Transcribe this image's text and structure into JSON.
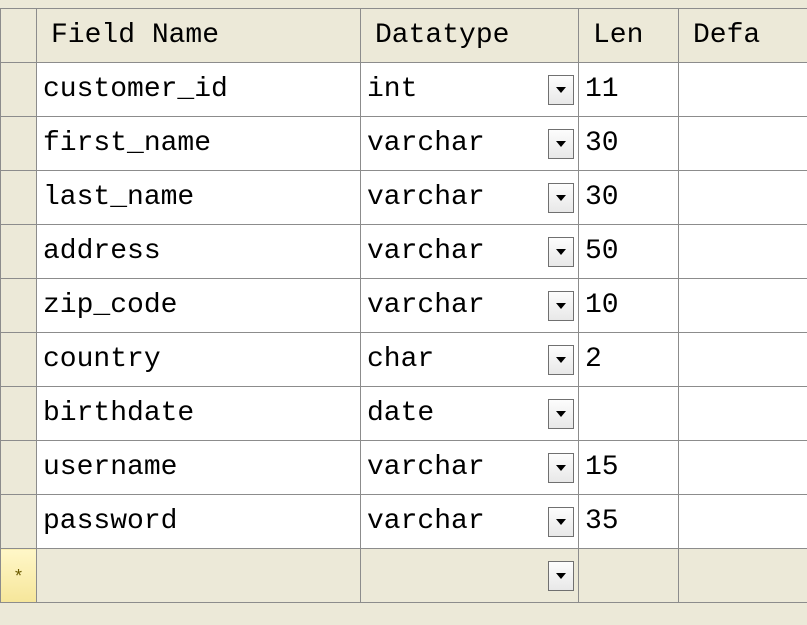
{
  "columns": {
    "field_name": "Field Name",
    "datatype": "Datatype",
    "len": "Len",
    "default": "Defa"
  },
  "newrow_marker": "*",
  "rows": [
    {
      "field": "customer_id",
      "datatype": "int",
      "len": "11",
      "default": ""
    },
    {
      "field": "first_name",
      "datatype": "varchar",
      "len": "30",
      "default": ""
    },
    {
      "field": "last_name",
      "datatype": "varchar",
      "len": "30",
      "default": ""
    },
    {
      "field": "address",
      "datatype": "varchar",
      "len": "50",
      "default": ""
    },
    {
      "field": "zip_code",
      "datatype": "varchar",
      "len": "10",
      "default": ""
    },
    {
      "field": "country",
      "datatype": "char",
      "len": "2",
      "default": ""
    },
    {
      "field": "birthdate",
      "datatype": "date",
      "len": "",
      "default": ""
    },
    {
      "field": "username",
      "datatype": "varchar",
      "len": "15",
      "default": ""
    },
    {
      "field": "password",
      "datatype": "varchar",
      "len": "35",
      "default": ""
    }
  ]
}
